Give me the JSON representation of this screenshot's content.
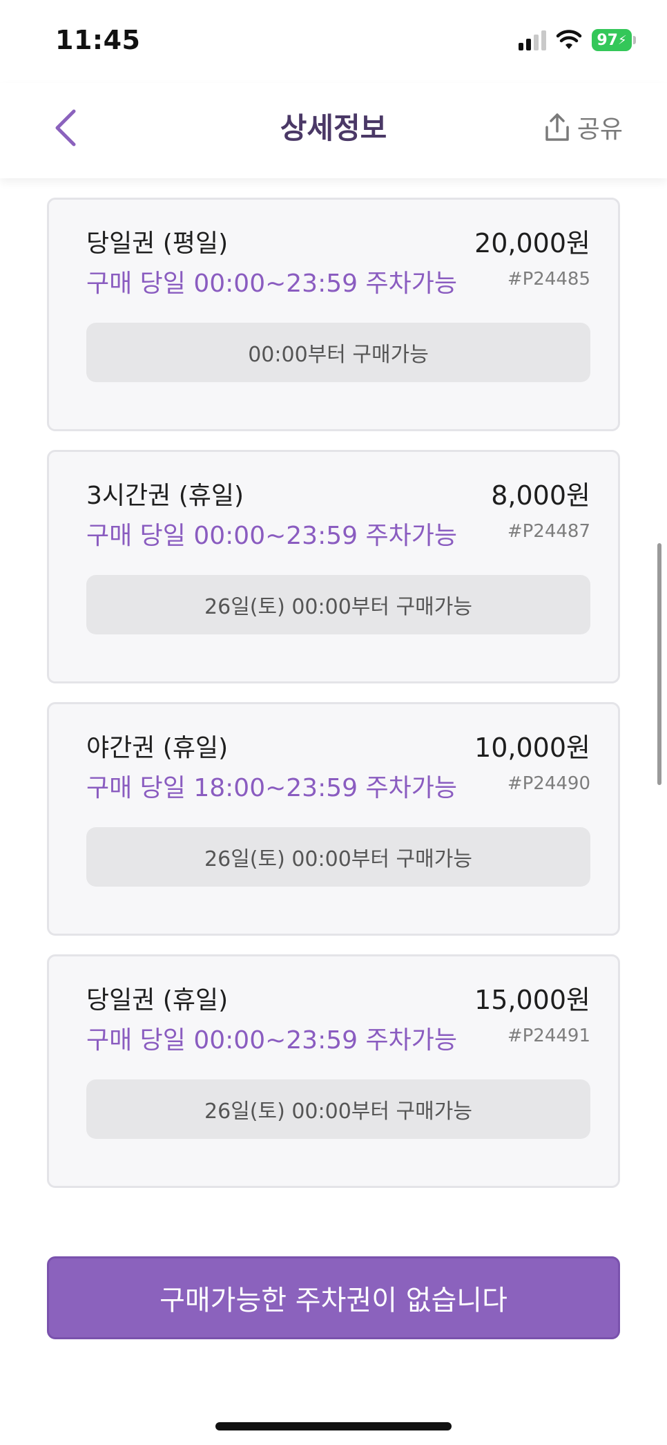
{
  "status_bar": {
    "time": "11:45",
    "battery": "97"
  },
  "header": {
    "title": "상세정보",
    "share_label": "공유"
  },
  "tickets": [
    {
      "name": "당일권 (평일)",
      "price": "20,000원",
      "hours": "구매 당일 00:00~23:59 주차가능",
      "code": "#P24485",
      "availability": "00:00부터 구매가능"
    },
    {
      "name": "3시간권 (휴일)",
      "price": "8,000원",
      "hours": "구매 당일 00:00~23:59 주차가능",
      "code": "#P24487",
      "availability": "26일(토) 00:00부터 구매가능"
    },
    {
      "name": "야간권 (휴일)",
      "price": "10,000원",
      "hours": "구매 당일 18:00~23:59 주차가능",
      "code": "#P24490",
      "availability": "26일(토) 00:00부터 구매가능"
    },
    {
      "name": "당일권 (휴일)",
      "price": "15,000원",
      "hours": "구매 당일 00:00~23:59 주차가능",
      "code": "#P24491",
      "availability": "26일(토) 00:00부터 구매가능"
    }
  ],
  "purchase_button": {
    "label": "구매가능한 주차권이 없습니다"
  },
  "colors": {
    "accent": "#8b62bd",
    "title": "#4a3866",
    "hours_text": "#8a5cc0",
    "battery": "#34c759"
  }
}
